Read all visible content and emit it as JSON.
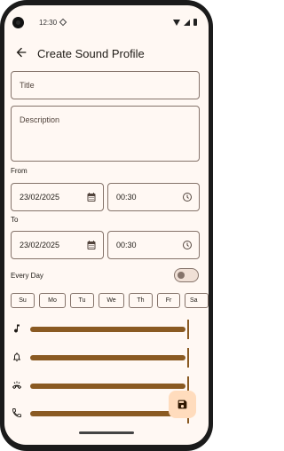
{
  "status_bar": {
    "time": "12:30"
  },
  "app_bar": {
    "title": "Create Sound Profile"
  },
  "fields": {
    "title_label": "Title",
    "description_label": "Description"
  },
  "from": {
    "label": "From",
    "date": "23/02/2025",
    "time": "00:30"
  },
  "to": {
    "label": "To",
    "date": "23/02/2025",
    "time": "00:30"
  },
  "every_day": {
    "label": "Every Day",
    "enabled": false
  },
  "days": [
    "Su",
    "Mo",
    "Tu",
    "We",
    "Th",
    "Fr",
    "Sa"
  ],
  "volume_sliders": [
    {
      "icon": "music-note-icon",
      "level": 1.0
    },
    {
      "icon": "bell-icon",
      "level": 1.0
    },
    {
      "icon": "ringtone-icon",
      "level": 1.0
    },
    {
      "icon": "phone-icon",
      "level": 1.0
    }
  ],
  "colors": {
    "accent": "#8a5a22",
    "background": "#fff8f3",
    "fab": "#ffdcbd"
  }
}
